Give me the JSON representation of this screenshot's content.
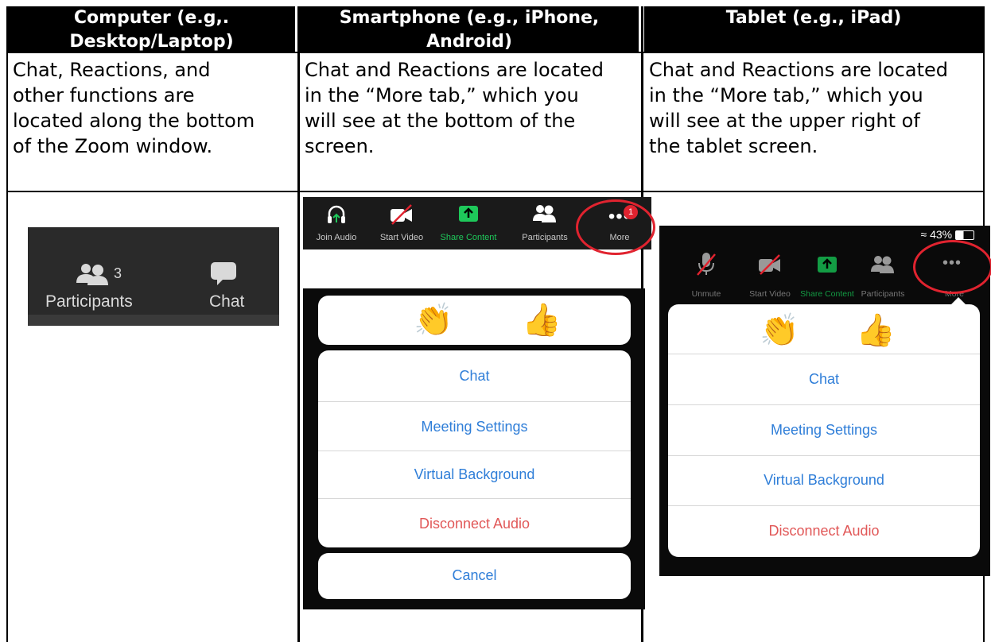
{
  "headers": [
    {
      "line1": "Computer (e.g,.",
      "line2": "Desktop/Laptop)"
    },
    {
      "line1": "Smartphone (e.g., iPhone,",
      "line2": "Android)"
    },
    {
      "line1": "Tablet (e.g., iPad)",
      "line2": ""
    }
  ],
  "descriptions": [
    [
      "Chat, Reactions, and",
      "other functions are",
      "located along the bottom",
      "of the Zoom window."
    ],
    [
      "Chat and Reactions are located",
      "in the “More tab,” which you",
      "will see at the bottom of the",
      "screen."
    ],
    [
      "Chat and Reactions are located",
      "in the “More tab,” which you",
      "will see at the upper right of",
      "the tablet screen."
    ]
  ],
  "computer": {
    "participants_label": "Participants",
    "participants_count": "3",
    "chat_label": "Chat"
  },
  "phone": {
    "toolbar": {
      "join_audio": "Join Audio",
      "start_video": "Start Video",
      "share_content": "Share Content",
      "participants": "Participants",
      "more": "More",
      "badge": "1"
    },
    "menu": {
      "chat": "Chat",
      "meeting_settings": "Meeting Settings",
      "virtual_background": "Virtual Background",
      "disconnect_audio": "Disconnect Audio",
      "cancel": "Cancel"
    },
    "reactions": [
      "👏",
      "👍"
    ]
  },
  "tablet": {
    "status": "43%",
    "toolbar": {
      "unmute": "Unmute",
      "start_video": "Start Video",
      "share_content": "Share Content",
      "participants": "Participants",
      "more": "More"
    },
    "menu": {
      "chat": "Chat",
      "meeting_settings": "Meeting Settings",
      "virtual_background": "Virtual Background",
      "disconnect_audio": "Disconnect Audio"
    },
    "reactions": [
      "👏",
      "👍"
    ]
  },
  "colors": {
    "accent_blue": "#2f7ed8",
    "danger_red": "#e15858",
    "share_green": "#1ec85a",
    "highlight_ring": "#e0232f"
  }
}
